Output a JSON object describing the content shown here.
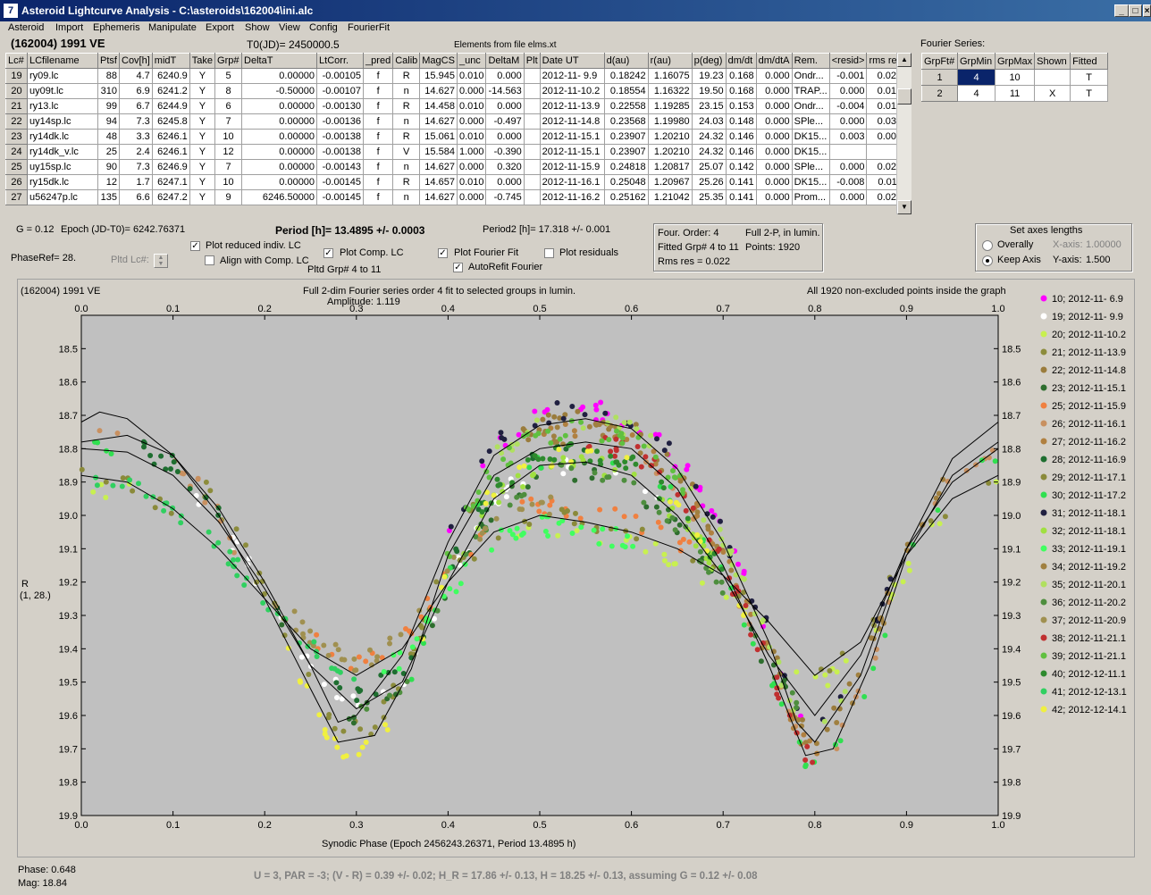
{
  "window": {
    "title": "Asteroid Lightcurve Analysis - C:\\asteroids\\162004\\ini.alc",
    "icon_glyph": "7",
    "controls": {
      "minimize": "_",
      "maximize": "□",
      "close": "×"
    }
  },
  "menu": [
    "Asteroid",
    "Import",
    "Ephemeris",
    "Manipulate",
    "Export",
    "Show",
    "View",
    "Config",
    "FourierFit"
  ],
  "header": {
    "asteroid": "(162004) 1991 VE",
    "t0": "T0(JD)= 2450000.5",
    "elements": "Elements from file elms.xt",
    "fourier_series_label": "Fourier Series:"
  },
  "lc_table": {
    "columns": [
      "Lc#",
      "LCfilename",
      "Ptsf",
      "Cov[h]",
      "midT",
      "Take",
      "Grp#",
      "DeltaT",
      "LtCorr.",
      "_pred",
      "Calib",
      "MagCS",
      "_unc",
      "DeltaM",
      "Plt",
      "Date UT",
      "d(au)",
      "r(au)",
      "p(deg)",
      "dm/dt",
      "dm/dtA",
      "Rem.",
      "<resid>",
      "rms res"
    ],
    "rows": [
      [
        "19",
        "ry09.lc",
        "88",
        "4.7",
        "6240.9",
        "Y",
        "5",
        "0.00000",
        "-0.00105",
        "f",
        "R",
        "15.945",
        "0.010",
        "0.000",
        "",
        "2012-11- 9.9",
        "0.18242",
        "1.16075",
        "19.23",
        "0.168",
        "0.000",
        "Ondr...",
        "-0.001",
        "0.025"
      ],
      [
        "20",
        "uy09t.lc",
        "310",
        "6.9",
        "6241.2",
        "Y",
        "8",
        "-0.50000",
        "-0.00107",
        "f",
        "n",
        "14.627",
        "0.000",
        "-14.563",
        "",
        "2012-11-10.2",
        "0.18554",
        "1.16322",
        "19.50",
        "0.168",
        "0.000",
        "TRAP...",
        "0.000",
        "0.016"
      ],
      [
        "21",
        "ry13.lc",
        "99",
        "6.7",
        "6244.9",
        "Y",
        "6",
        "0.00000",
        "-0.00130",
        "f",
        "R",
        "14.458",
        "0.010",
        "0.000",
        "",
        "2012-11-13.9",
        "0.22558",
        "1.19285",
        "23.15",
        "0.153",
        "0.000",
        "Ondr...",
        "-0.004",
        "0.017"
      ],
      [
        "22",
        "uy14sp.lc",
        "94",
        "7.3",
        "6245.8",
        "Y",
        "7",
        "0.00000",
        "-0.00136",
        "f",
        "n",
        "14.627",
        "0.000",
        "-0.497",
        "",
        "2012-11-14.8",
        "0.23568",
        "1.19980",
        "24.03",
        "0.148",
        "0.000",
        "SPle...",
        "0.000",
        "0.030"
      ],
      [
        "23",
        "ry14dk.lc",
        "48",
        "3.3",
        "6246.1",
        "Y",
        "10",
        "0.00000",
        "-0.00138",
        "f",
        "R",
        "15.061",
        "0.010",
        "0.000",
        "",
        "2012-11-15.1",
        "0.23907",
        "1.20210",
        "24.32",
        "0.146",
        "0.000",
        "DK15...",
        "0.003",
        "0.009"
      ],
      [
        "24",
        "ry14dk_v.lc",
        "25",
        "2.4",
        "6246.1",
        "Y",
        "12",
        "0.00000",
        "-0.00138",
        "f",
        "V",
        "15.584",
        "1.000",
        "-0.390",
        "",
        "2012-11-15.1",
        "0.23907",
        "1.20210",
        "24.32",
        "0.146",
        "0.000",
        "DK15...",
        "",
        ""
      ],
      [
        "25",
        "uy15sp.lc",
        "90",
        "7.3",
        "6246.9",
        "Y",
        "7",
        "0.00000",
        "-0.00143",
        "f",
        "n",
        "14.627",
        "0.000",
        "0.320",
        "",
        "2012-11-15.9",
        "0.24818",
        "1.20817",
        "25.07",
        "0.142",
        "0.000",
        "SPle...",
        "0.000",
        "0.023"
      ],
      [
        "26",
        "ry15dk.lc",
        "12",
        "1.7",
        "6247.1",
        "Y",
        "10",
        "0.00000",
        "-0.00145",
        "f",
        "R",
        "14.657",
        "0.010",
        "0.000",
        "",
        "2012-11-16.1",
        "0.25048",
        "1.20967",
        "25.26",
        "0.141",
        "0.000",
        "DK15...",
        "-0.008",
        "0.011"
      ],
      [
        "27",
        "u56247p.lc",
        "135",
        "6.6",
        "6247.2",
        "Y",
        "9",
        "6246.50000",
        "-0.00145",
        "f",
        "n",
        "14.627",
        "0.000",
        "-0.745",
        "",
        "2012-11-16.2",
        "0.25162",
        "1.21042",
        "25.35",
        "0.141",
        "0.000",
        "Prom...",
        "0.000",
        "0.021"
      ]
    ]
  },
  "fourier_table": {
    "columns": [
      "GrpFt#",
      "GrpMin",
      "GrpMax",
      "Shown",
      "Fitted"
    ],
    "rows": [
      [
        "1",
        "4",
        "10",
        "",
        "T"
      ],
      [
        "2",
        "4",
        "11",
        "X",
        "T"
      ]
    ]
  },
  "info": {
    "g": "G = 0.12",
    "epoch": "Epoch (JD-T0)= 6242.76371",
    "period": "Period [h]= 13.4895 +/- 0.0003",
    "period2": "Period2 [h]= 17.318 +/- 0.001",
    "phaseref": "PhaseRef= 28.",
    "pltd_lc": "Pltd Lc#:",
    "pltd_grp": "Pltd Grp#  4  to  11"
  },
  "checkboxes": {
    "plot_reduced": {
      "label": "Plot reduced indiv. LC",
      "checked": true
    },
    "align_comp": {
      "label": "Align with Comp. LC",
      "checked": false
    },
    "plot_comp": {
      "label": "Plot Comp. LC",
      "checked": true
    },
    "plot_fourier": {
      "label": "Plot Fourier Fit",
      "checked": true
    },
    "autorefit": {
      "label": "AutoRefit Fourier",
      "checked": true
    },
    "plot_residuals": {
      "label": "Plot residuals",
      "checked": false
    }
  },
  "fit_summary": {
    "order": "Four. Order:  4",
    "full": "Full 2-P, in lumin.",
    "fitted": "Fitted Grp# 4 to 11",
    "points": "Points: 1920",
    "rms": "Rms res     = 0.022"
  },
  "axes_box": {
    "title": "Set axes lengths",
    "overally": "Overally",
    "keep_axis": "Keep Axis",
    "selected": "keep_axis",
    "x_label": "X-axis:",
    "x_value": "1.00000",
    "y_label": "Y-axis:",
    "y_value": "1.500"
  },
  "plot": {
    "name": "(162004) 1991 VE",
    "fit_desc": "Full 2-dim Fourier series order 4 fit to selected groups in lumin.",
    "amplitude": "Amplitude: 1.119",
    "points_note": "All 1920 non-excluded points inside the graph",
    "ylabel": "R",
    "ylabel2": "(1, 28.)",
    "xlabel": "Synodic Phase (Epoch 2456243.26371, Period 13.4895 h)"
  },
  "chart_data": {
    "type": "scatter",
    "xlim": [
      0.0,
      1.0
    ],
    "ylim": [
      18.4,
      19.9
    ],
    "y_inverted": true,
    "x_ticks": [
      "0.0",
      "0.1",
      "0.2",
      "0.3",
      "0.4",
      "0.5",
      "0.6",
      "0.7",
      "0.8",
      "0.9",
      "1.0"
    ],
    "y_ticks": [
      "18.5",
      "18.6",
      "18.7",
      "18.8",
      "18.9",
      "19.0",
      "19.1",
      "19.2",
      "19.3",
      "19.4",
      "19.5",
      "19.6",
      "19.7",
      "19.8",
      "19.9"
    ],
    "legend_position": "right",
    "series": [
      {
        "name": "10; 2012-11- 6.9",
        "color": "#ff00ff"
      },
      {
        "name": "19; 2012-11- 9.9",
        "color": "#ffffff"
      },
      {
        "name": "20; 2012-11-10.2",
        "color": "#c8f050"
      },
      {
        "name": "21; 2012-11-13.9",
        "color": "#8c8c3c"
      },
      {
        "name": "22; 2012-11-14.8",
        "color": "#9a7c3c"
      },
      {
        "name": "23; 2012-11-15.1",
        "color": "#2e6e2e"
      },
      {
        "name": "25; 2012-11-15.9",
        "color": "#f08040"
      },
      {
        "name": "26; 2012-11-16.1",
        "color": "#c89060"
      },
      {
        "name": "27; 2012-11-16.2",
        "color": "#b08040"
      },
      {
        "name": "28; 2012-11-16.9",
        "color": "#1e6e30"
      },
      {
        "name": "29; 2012-11-17.1",
        "color": "#8a8a3a"
      },
      {
        "name": "30; 2012-11-17.2",
        "color": "#30e050"
      },
      {
        "name": "31; 2012-11-18.1",
        "color": "#202040"
      },
      {
        "name": "32; 2012-11-18.1",
        "color": "#a0e040"
      },
      {
        "name": "33; 2012-11-19.1",
        "color": "#40ff60"
      },
      {
        "name": "34; 2012-11-19.2",
        "color": "#a08040"
      },
      {
        "name": "35; 2012-11-20.1",
        "color": "#b0e060"
      },
      {
        "name": "36; 2012-11-20.2",
        "color": "#4e8e3e"
      },
      {
        "name": "37; 2012-11-20.9",
        "color": "#a09050"
      },
      {
        "name": "38; 2012-11-21.1",
        "color": "#c03030"
      },
      {
        "name": "39; 2012-11-21.1",
        "color": "#60c040"
      },
      {
        "name": "40; 2012-12-11.1",
        "color": "#2e8a2e"
      },
      {
        "name": "41; 2012-12-13.1",
        "color": "#30d060"
      },
      {
        "name": "42; 2012-12-14.1",
        "color": "#f0f040"
      }
    ],
    "fit_curves": [
      {
        "color": "#000000",
        "points": [
          [
            0.0,
            18.72
          ],
          [
            0.02,
            18.69
          ],
          [
            0.05,
            18.71
          ],
          [
            0.1,
            18.82
          ],
          [
            0.15,
            18.98
          ],
          [
            0.2,
            19.2
          ],
          [
            0.25,
            19.45
          ],
          [
            0.28,
            19.62
          ],
          [
            0.3,
            19.6
          ],
          [
            0.35,
            19.42
          ],
          [
            0.4,
            19.08
          ],
          [
            0.45,
            18.82
          ],
          [
            0.5,
            18.73
          ],
          [
            0.55,
            18.71
          ],
          [
            0.6,
            18.74
          ],
          [
            0.65,
            18.86
          ],
          [
            0.7,
            19.08
          ],
          [
            0.75,
            19.38
          ],
          [
            0.78,
            19.62
          ],
          [
            0.8,
            19.68
          ],
          [
            0.85,
            19.48
          ],
          [
            0.9,
            19.1
          ],
          [
            0.95,
            18.83
          ],
          [
            1.0,
            18.72
          ]
        ]
      },
      {
        "color": "#000000",
        "points": [
          [
            0.0,
            18.8
          ],
          [
            0.05,
            18.81
          ],
          [
            0.1,
            18.88
          ],
          [
            0.15,
            19.02
          ],
          [
            0.2,
            19.22
          ],
          [
            0.25,
            19.45
          ],
          [
            0.3,
            19.58
          ],
          [
            0.35,
            19.5
          ],
          [
            0.4,
            19.2
          ],
          [
            0.45,
            18.95
          ],
          [
            0.5,
            18.85
          ],
          [
            0.55,
            18.84
          ],
          [
            0.6,
            18.88
          ],
          [
            0.65,
            19.0
          ],
          [
            0.7,
            19.18
          ],
          [
            0.75,
            19.42
          ],
          [
            0.8,
            19.6
          ],
          [
            0.85,
            19.42
          ],
          [
            0.9,
            19.1
          ],
          [
            0.95,
            18.9
          ],
          [
            1.0,
            18.8
          ]
        ]
      },
      {
        "color": "#000000",
        "points": [
          [
            0.0,
            18.88
          ],
          [
            0.05,
            18.9
          ],
          [
            0.1,
            18.98
          ],
          [
            0.15,
            19.1
          ],
          [
            0.2,
            19.25
          ],
          [
            0.25,
            19.4
          ],
          [
            0.3,
            19.48
          ],
          [
            0.35,
            19.4
          ],
          [
            0.4,
            19.2
          ],
          [
            0.45,
            19.05
          ],
          [
            0.5,
            19.0
          ],
          [
            0.55,
            19.02
          ],
          [
            0.6,
            19.05
          ],
          [
            0.65,
            19.1
          ],
          [
            0.7,
            19.18
          ],
          [
            0.75,
            19.32
          ],
          [
            0.8,
            19.48
          ],
          [
            0.85,
            19.38
          ],
          [
            0.9,
            19.12
          ],
          [
            0.95,
            18.95
          ],
          [
            1.0,
            18.88
          ]
        ]
      },
      {
        "color": "#000000",
        "points": [
          [
            0.0,
            18.78
          ],
          [
            0.05,
            18.76
          ],
          [
            0.1,
            18.82
          ],
          [
            0.15,
            19.0
          ],
          [
            0.2,
            19.25
          ],
          [
            0.25,
            19.52
          ],
          [
            0.28,
            19.68
          ],
          [
            0.32,
            19.66
          ],
          [
            0.36,
            19.46
          ],
          [
            0.4,
            19.12
          ],
          [
            0.45,
            18.88
          ],
          [
            0.5,
            18.8
          ],
          [
            0.55,
            18.78
          ],
          [
            0.6,
            18.8
          ],
          [
            0.65,
            18.92
          ],
          [
            0.7,
            19.15
          ],
          [
            0.75,
            19.45
          ],
          [
            0.79,
            19.72
          ],
          [
            0.82,
            19.7
          ],
          [
            0.86,
            19.45
          ],
          [
            0.9,
            19.12
          ],
          [
            0.95,
            18.88
          ],
          [
            1.0,
            18.78
          ]
        ]
      }
    ]
  },
  "status": {
    "phase": "Phase:  0.648",
    "mag": "Mag:    18.84",
    "result": "U = 3, PAR = -3; (V - R) = 0.39 +/- 0.02; H_R = 17.86 +/- 0.13, H = 18.25 +/- 0.13, assuming G = 0.12 +/- 0.08"
  }
}
